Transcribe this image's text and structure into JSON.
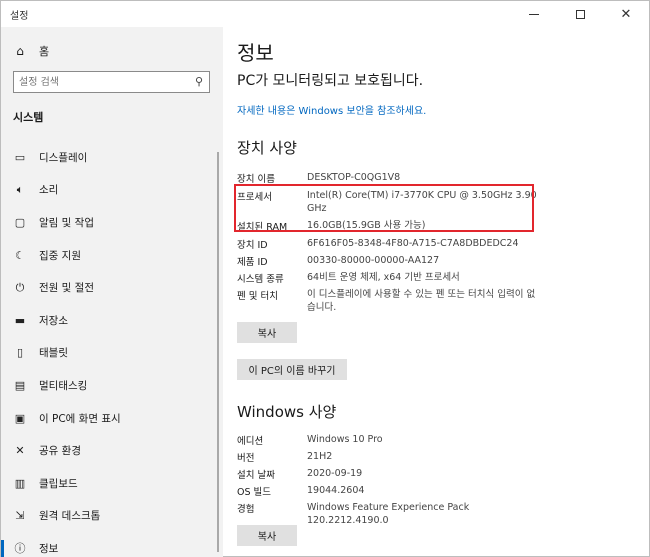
{
  "window": {
    "title": "설정"
  },
  "sidebar": {
    "home_label": "홈",
    "search_placeholder": "설정 검색",
    "section_heading": "시스템",
    "items": [
      {
        "label": "디스플레이",
        "icon": "display-icon"
      },
      {
        "label": "소리",
        "icon": "speaker-icon"
      },
      {
        "label": "알림 및 작업",
        "icon": "notification-icon"
      },
      {
        "label": "집중 지원",
        "icon": "moon-icon"
      },
      {
        "label": "전원 및 절전",
        "icon": "power-icon"
      },
      {
        "label": "저장소",
        "icon": "storage-icon"
      },
      {
        "label": "태블릿",
        "icon": "tablet-icon"
      },
      {
        "label": "멀티태스킹",
        "icon": "multitask-icon"
      },
      {
        "label": "이 PC에 화면 표시",
        "icon": "project-icon"
      },
      {
        "label": "공유 환경",
        "icon": "share-icon"
      },
      {
        "label": "클립보드",
        "icon": "clipboard-icon"
      },
      {
        "label": "원격 데스크톱",
        "icon": "remote-icon"
      },
      {
        "label": "정보",
        "icon": "info-icon"
      }
    ]
  },
  "main": {
    "title": "정보",
    "protect_text": "PC가 모니터링되고 보호됩니다.",
    "security_link": "자세한 내용은 Windows 보안을 참조하세요.",
    "device_specs": {
      "heading": "장치 사양",
      "rows": [
        {
          "k": "장치 이름",
          "v": "DESKTOP-C0QG1V8"
        },
        {
          "k": "프로세서",
          "v": "Intel(R) Core(TM) i7-3770K CPU @ 3.50GHz   3.90 GHz"
        },
        {
          "k": "설치된 RAM",
          "v": "16.0GB(15.9GB 사용 가능)"
        },
        {
          "k": "장치 ID",
          "v": "6F616F05-8348-4F80-A715-C7A8DBDEDC24"
        },
        {
          "k": "제품 ID",
          "v": "00330-80000-00000-AA127"
        },
        {
          "k": "시스템 종류",
          "v": "64비트 운영 체제, x64 기반 프로세서"
        },
        {
          "k": "펜 및 터치",
          "v": "이 디스플레이에 사용할 수 있는 펜 또는 터치식 입력이 없습니다."
        }
      ],
      "copy_button": "복사",
      "rename_button": "이 PC의 이름 바꾸기"
    },
    "windows_specs": {
      "heading": "Windows 사양",
      "rows": [
        {
          "k": "에디션",
          "v": "Windows 10 Pro"
        },
        {
          "k": "버전",
          "v": "21H2"
        },
        {
          "k": "설치 날짜",
          "v": "2020-09-19"
        },
        {
          "k": "OS 빌드",
          "v": "19044.2604"
        },
        {
          "k": "경험",
          "v": "Windows Feature Experience Pack 120.2212.4190.0"
        }
      ],
      "copy_button": "복사"
    }
  },
  "colors": {
    "accent": "#0067c0",
    "highlight": "#e2262d",
    "sidebar_bg": "#f2f2f2"
  }
}
